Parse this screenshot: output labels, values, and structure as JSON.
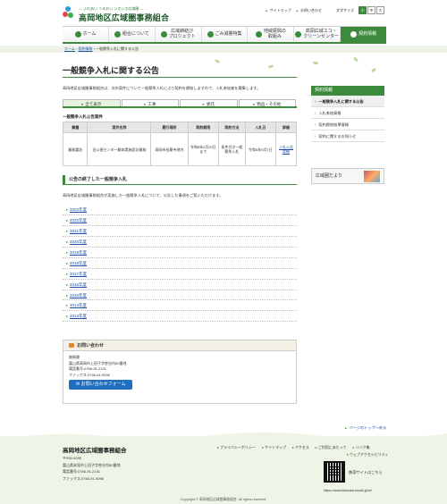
{
  "header": {
    "tagline": "— ふれあい うるおい いきいき広域圏 —",
    "site_title": "高岡地区広域圏事務組合",
    "util_links": [
      "サイトマップ",
      "お問い合わせ"
    ],
    "font_label": "文字サイズ",
    "font_sizes": [
      "小",
      "中",
      "大"
    ]
  },
  "gnav": [
    "ホーム",
    "組合について",
    "広域締結び\nプロジェクト",
    "ごみ減量特集",
    "地域振興の\n取組み",
    "高岡広域エコ・\nクリーンセンター",
    "契約情報"
  ],
  "breadcrumb": {
    "home": "ホーム",
    "parent": "契約情報",
    "current": "一般競争入札に関する公告"
  },
  "page_title": "一般競争入札に関する公告",
  "intro": "高岡地区広域圏事務組合は、次の案件について一般競争入札により契約を締結しますので、入札参加者を募集します。",
  "tabs": [
    "全て表示",
    "工事",
    "委託",
    "物品・その他"
  ],
  "table_title": "一般競争入札公告案件",
  "table": {
    "headers": [
      "業種",
      "案件名称",
      "履行場所",
      "契約期限",
      "契約方法",
      "入札日",
      "詳細"
    ],
    "rows": [
      [
        "業務委託",
        "旧公害センター解体実施設計業務",
        "高岡市長慶寺地内",
        "令和8年2月20日まで",
        "条件付き一般競争入札",
        "令和5年9月7日",
        "入札公告詳細"
      ]
    ]
  },
  "ended_title": "公告の終了した一般競争入札",
  "ended_text": "高岡地区広域圏事務組合が実施した一般競争入札について、公告した事項をご覧いただけます。",
  "years": [
    "2023年度",
    "2022年度",
    "2021年度",
    "2020年度",
    "2019年度",
    "2018年度",
    "2017年度",
    "2016年度",
    "2015年度",
    "2014年度",
    "2013年度"
  ],
  "contact": {
    "title": "お問い合わせ",
    "dept": "総務課",
    "address": "富山県高岡市上田子字笹谷内50番地",
    "tel": "電話番号:0766-91-2101",
    "fax": "ファックス:0766-91-9096",
    "button": "お問い合わせフォーム"
  },
  "side": {
    "head": "契約情報",
    "items": [
      "一般競争入札に関する公告",
      "入札参加資格",
      "契約締結結果情報",
      "契約に関するお知らせ"
    ],
    "first_item": "契約情報",
    "banner": "広域圏だより"
  },
  "pagetop": "ページのトップへ戻る",
  "footer": {
    "org": "高岡地区広域圏事務組合",
    "zip": "〒935-0035",
    "addr": "富山県氷見市上田子字笹谷内50番地",
    "tel": "電話番号:0766-91-2101",
    "fax": "ファックス:0766-91-9096",
    "links": [
      "プライバシーポリシー",
      "サイトマップ",
      "アクセス",
      "ご利用にあたって",
      "リンク集"
    ],
    "link_extra": "ウェブアクセシビリティ",
    "qr_label": "携帯サイトはこちら",
    "qr_url": "https://www.takaoka-kouiki.jp/m/",
    "copyright": "Copyright © 高岡地区広域圏事務組合. All rights reserved."
  },
  "colors": {
    "brand_green": "#3c8a3c",
    "link_blue": "#1a4fa0"
  }
}
